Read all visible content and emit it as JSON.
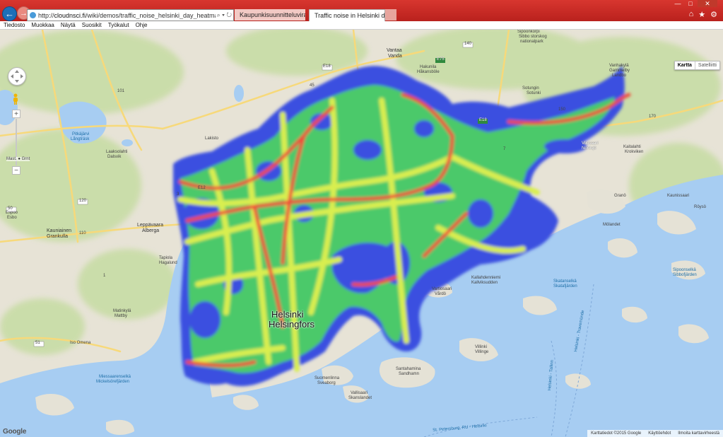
{
  "browser": {
    "url_prefix": "http://",
    "url_domain": "cloudnsci.fi",
    "url_path": "/wiki/demos/traffic_noise_helsinki_day_heatmap.html",
    "address_controls": "⌕ ▾ ↻",
    "tabs": [
      {
        "label": "Kaupunkisuunnitteluvirasto",
        "icon": "city-planning-favicon",
        "active": false
      },
      {
        "label": "Traffic noise in Helsinki duri...",
        "icon": "ie-favicon",
        "active": true
      }
    ],
    "tab_close": "×",
    "toolbar_icons": [
      "home-icon",
      "favorites-star-icon",
      "tools-gear-icon"
    ],
    "window_buttons": [
      "minimize",
      "maximize",
      "close"
    ]
  },
  "menubar": {
    "items": [
      "Tiedosto",
      "Muokkaa",
      "Näytä",
      "Suosikit",
      "Työkalut",
      "Ohje"
    ]
  },
  "map": {
    "type_control": {
      "map": "Kartta",
      "satellite": "Satelliitti",
      "active": "Kartta"
    },
    "zoom": {
      "in": "+",
      "out": "−",
      "label": "Mast. ● Grnt"
    },
    "attribution": [
      "Karttatiedot ©2015 Google",
      "Käyttöehdot",
      "Ilmoita karttavirheestä"
    ],
    "logo": "Google",
    "colors": {
      "land": "#e7e3d6",
      "forest": "#c4dba1",
      "water": "#a7cdf2",
      "noise_low": "#3b4fe0",
      "noise_mid": "#4cc96b",
      "noise_high": "#d9ee4f",
      "noise_peak": "#ef4a3a",
      "road_major": "#f4c242"
    },
    "places_large": [
      "Helsinki",
      "Helsingfors"
    ],
    "places": [
      "Vantaa",
      "Vanda",
      "Sipoonkorpi",
      "Sibbo storskog",
      "nationalpark",
      "Pitkäjärvi",
      "Långträsk",
      "Espoo",
      "Esbo",
      "Kauniainen",
      "Grankulla",
      "Leppävaara",
      "Alberga",
      "Laaksolahti",
      "Dalsvik",
      "Matinkylä",
      "Mattby",
      "Tapiola",
      "Hagalund",
      "Iso Omena",
      "Kallahdenniemi",
      "Kallviksudden",
      "Vartiosaari",
      "Vårdö",
      "Villinki",
      "Villinge",
      "Santahamina",
      "Sandhamn",
      "Suomenlinna",
      "Sveaborg",
      "Vallisaari",
      "Skanslandet",
      "Skatanselkä",
      "Skatafjärden",
      "Miessaarenselkä",
      "Mickelsörefjärden",
      "Sipoonselkä",
      "Sibbofjärden",
      "Mölandet",
      "Granö",
      "Röysö",
      "Kaunissaari",
      "Vuosaari",
      "Nordsjö",
      "Kaitalahti",
      "Krokviken",
      "Sotungin",
      "Sotunki",
      "Hakunila",
      "Håkansböle",
      "Lakisto",
      "Vanhakylä",
      "Gammelby",
      "Landbo"
    ],
    "road_numbers": [
      "E18",
      "E18",
      "E75",
      "E12",
      "45",
      "120",
      "110",
      "140",
      "150",
      "170",
      "101",
      "51",
      "7",
      "50",
      "1",
      "3"
    ],
    "shipping_lanes": [
      "Helsinki - Travemünde",
      "Helsinki - Tallinn",
      "St. Petersburg, RU - Helsinki"
    ]
  }
}
